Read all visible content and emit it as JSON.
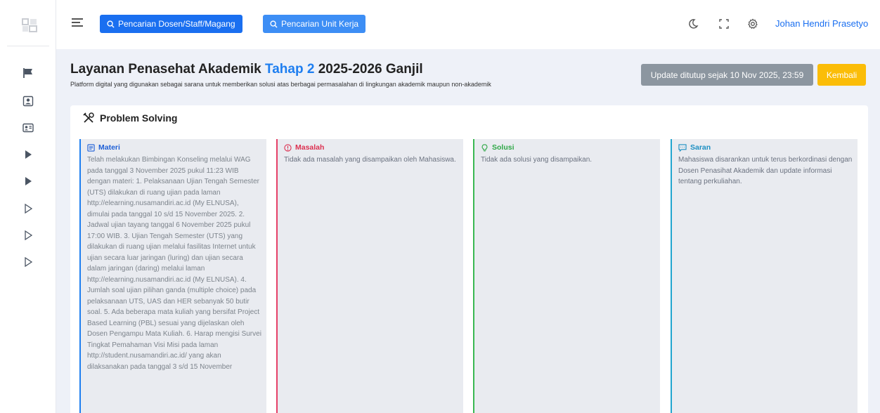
{
  "topbar": {
    "search_dosen_label": "Pencarian Dosen/Staff/Magang",
    "search_unit_label": "Pencarian Unit Kerja",
    "user_name": "Johan Hendri Prasetyo"
  },
  "page": {
    "title_prefix": "Layanan Penasehat Akademik",
    "title_accent": "Tahap 2",
    "title_suffix": "2025-2026 Ganjil",
    "subtitle": "Platform digital yang digunakan sebagai sarana untuk memberikan solusi atas berbagai permasalahan di lingkungan akademik maupun non-akademik",
    "closed_label": "Update ditutup sejak 10 Nov 2025, 23:59",
    "back_label": "Kembali"
  },
  "card": {
    "title": "Problem Solving",
    "columns": [
      {
        "title": "Materi",
        "body": "Telah melakukan Bimbingan Konseling melalui WAG pada tanggal 3 November 2025 pukul 11:23 WIB dengan materi: 1. Pelaksanaan Ujian Tengah Semester (UTS) dilakukan di ruang ujian pada laman http://elearning.nusamandiri.ac.id (My ELNUSA), dimulai pada tanggal 10 s/d 15 November 2025. 2. Jadwal ujian tayang tanggal 6 November 2025 pukul 17:00 WIB. 3. Ujian Tengah Semester (UTS) yang dilakukan di ruang ujian melalui fasilitas Internet untuk ujian secara luar jaringan (luring) dan ujian secara dalam jaringan (daring) melalui laman http://elearning.nusamandiri.ac.id (My ELNUSA). 4. Jumlah soal ujian pilihan ganda (multiple choice) pada pelaksanaan UTS, UAS dan HER sebanyak 50 butir soal. 5. Ada beberapa mata kuliah yang bersifat Project Based Learning (PBL) sesuai yang dijelaskan oleh Dosen Pengampu Mata Kuliah. 6. Harap mengisi Survei Tingkat Pemahaman Visi Misi pada laman http://student.nusamandiri.ac.id/ yang akan dilaksanakan pada tanggal 3 s/d 15 November"
      },
      {
        "title": "Masalah",
        "body": "Tidak ada masalah yang disampaikan oleh Mahasiswa."
      },
      {
        "title": "Solusi",
        "body": "Tidak ada solusi yang disampaikan."
      },
      {
        "title": "Saran",
        "body": "Mahasiswa disarankan untuk terus berkordinasi dengan Dosen Penasihat Akademik dan update informasi tentang perkuliahan."
      }
    ]
  },
  "colors": {
    "primary": "#1a6ff0",
    "warning": "#fbbd08",
    "materi": "#1e7ef0",
    "masalah": "#e64067",
    "solusi": "#3ab852",
    "saran": "#22a5cf"
  }
}
